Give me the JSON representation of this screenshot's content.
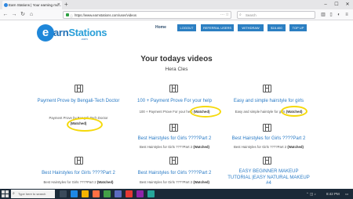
{
  "browser": {
    "tab_title": "Earn Stations | Your earning mo...",
    "url": "https://www.earnstations.com/user/videos",
    "search_placeholder": "Search"
  },
  "site": {
    "logo_letter": "e",
    "logo_rest_a": "arn",
    "logo_rest_b": "Stations",
    "logo_sub": ".com",
    "nav": {
      "home": "Home",
      "logout": "LOGOUT",
      "referral": "REFERRAL USERS",
      "withdraw": "WITHDRAW",
      "balance": "$16.460",
      "topup": "TOP UP"
    }
  },
  "main": {
    "title": "Your todays videos",
    "user_name": "Hera Cles",
    "videos": [
      {
        "title": "Payment Prove by Bengali-Tech Doctor",
        "sub": "Payment Prove by Bengali-Tech Doctor",
        "status": "(Watched)"
      },
      {
        "title": "100 + Payment Prove For your help",
        "sub": "100 + Payment Prove For your help",
        "status": "(Watched)"
      },
      {
        "title": "Easy and simple hairstyle for girls",
        "sub": "Easy and simple hairstyle for girls",
        "status": "(Watched)"
      },
      {
        "title": "Best Hairstyles for Girls ????Part 2",
        "sub": "Best Hairstyles for Girls ????Part 2",
        "status": "(Watched)"
      },
      {
        "title": "Best Hairstyles for Girls ????Part 2",
        "sub": "Best Hairstyles for Girls ????Part 2",
        "status": "(Watched)"
      },
      {
        "title": "Best Hairstyles for Girls ????Part 2",
        "sub": "Best Hairstyles for Girls ????Part 2",
        "status": "(Watched)"
      },
      {
        "title": "Best Hairstyles for Girls ????Part 2",
        "sub": "Best Hairstyles for Girls ????Part 2",
        "status": "(Watched)"
      },
      {
        "title": "EASY BEGINNER MAKEUP TUTORIAL |EASY NATURAL MAKEUP #4",
        "sub": "",
        "status": ""
      }
    ]
  },
  "taskbar": {
    "search_text": "Type here to search",
    "time": "8:42 PM"
  },
  "colors": {
    "accent": "#2b7fc2",
    "link": "#2a7bc6",
    "highlight": "#f5d90a"
  }
}
